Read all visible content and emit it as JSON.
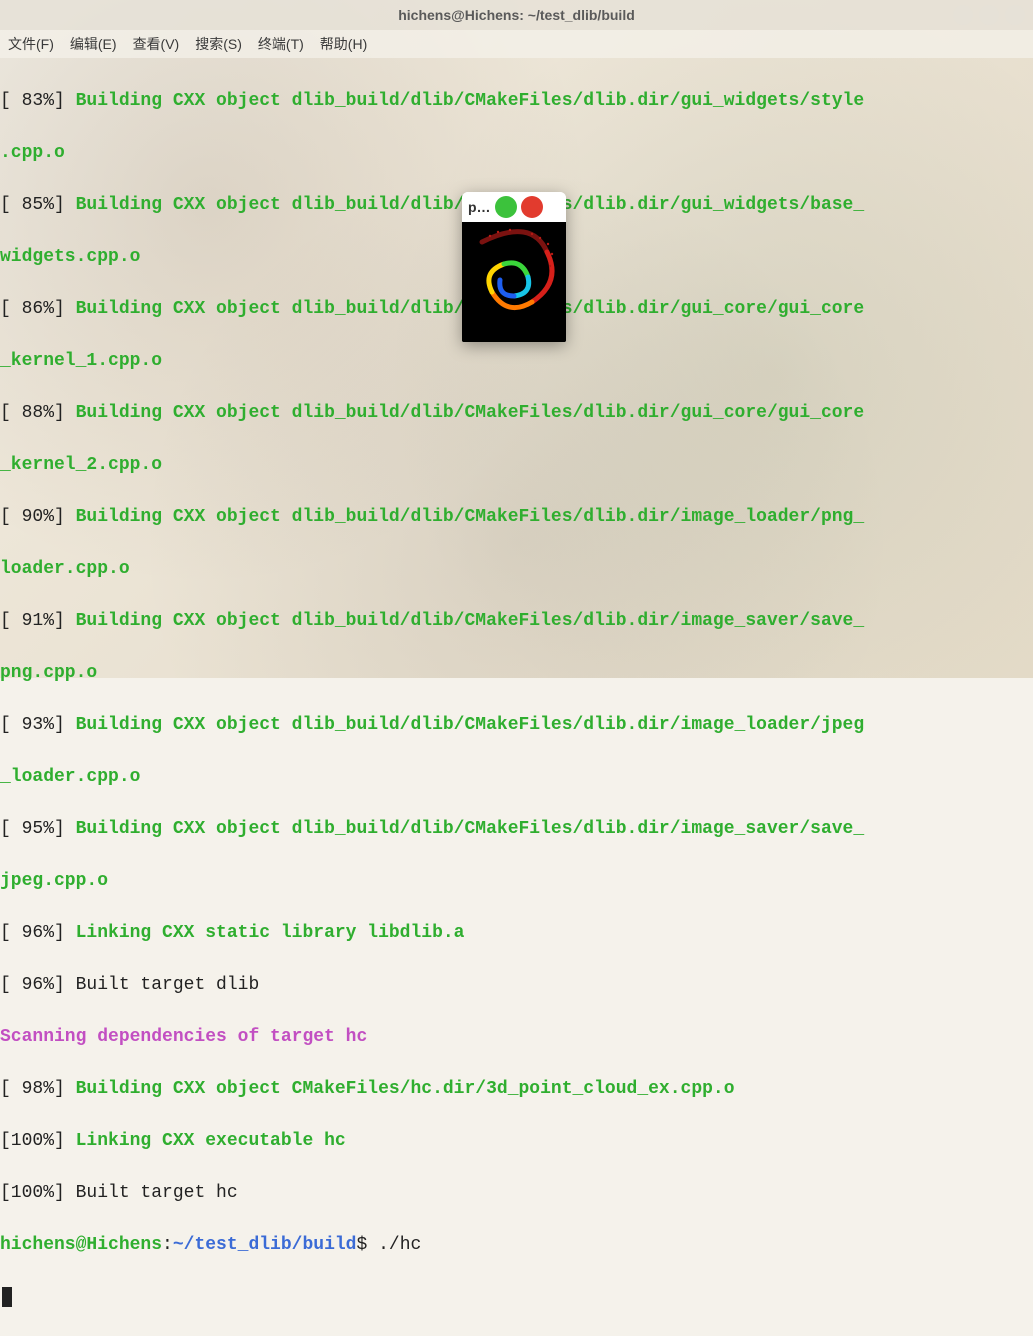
{
  "window": {
    "title": "hichens@Hichens: ~/test_dlib/build"
  },
  "menubar": {
    "items": [
      {
        "label": "文件(F)"
      },
      {
        "label": "编辑(E)"
      },
      {
        "label": "查看(V)"
      },
      {
        "label": "搜索(S)"
      },
      {
        "label": "终端(T)"
      },
      {
        "label": "帮助(H)"
      }
    ]
  },
  "lines": {
    "l0": {
      "pct": "[ 83%] ",
      "txt": "Building CXX object dlib_build/dlib/CMakeFiles/dlib.dir/gui_widgets/style"
    },
    "l0b": ".cpp.o",
    "l1": {
      "pct": "[ 85%] ",
      "txt": "Building CXX object dlib_build/dlib/CMakeFiles/dlib.dir/gui_widgets/base_"
    },
    "l1b": "widgets.cpp.o",
    "l2": {
      "pct": "[ 86%] ",
      "txt": "Building CXX object dlib_build/dlib/CMakeFiles/dlib.dir/gui_core/gui_core"
    },
    "l2b": "_kernel_1.cpp.o",
    "l3": {
      "pct": "[ 88%] ",
      "txt": "Building CXX object dlib_build/dlib/CMakeFiles/dlib.dir/gui_core/gui_core"
    },
    "l3b": "_kernel_2.cpp.o",
    "l4": {
      "pct": "[ 90%] ",
      "txt": "Building CXX object dlib_build/dlib/CMakeFiles/dlib.dir/image_loader/png_"
    },
    "l4b": "loader.cpp.o",
    "l5": {
      "pct": "[ 91%] ",
      "txt": "Building CXX object dlib_build/dlib/CMakeFiles/dlib.dir/image_saver/save_"
    },
    "l5b": "png.cpp.o",
    "l6": {
      "pct": "[ 93%] ",
      "txt": "Building CXX object dlib_build/dlib/CMakeFiles/dlib.dir/image_loader/jpeg"
    },
    "l6b": "_loader.cpp.o",
    "l7": {
      "pct": "[ 95%] ",
      "txt": "Building CXX object dlib_build/dlib/CMakeFiles/dlib.dir/image_saver/save_"
    },
    "l7b": "jpeg.cpp.o",
    "l8": {
      "pct": "[ 96%] ",
      "txt": "Linking CXX static library libdlib.a"
    },
    "l9": {
      "pct": "[ 96%] ",
      "txt": "Built target dlib"
    },
    "l10": "Scanning dependencies of target hc",
    "l11": {
      "pct": "[ 98%] ",
      "txt": "Building CXX object CMakeFiles/hc.dir/3d_point_cloud_ex.cpp.o"
    },
    "l12": {
      "pct": "[100%] ",
      "txt": "Linking CXX executable hc"
    },
    "l13": {
      "pct": "[100%] ",
      "txt": "Built target hc"
    }
  },
  "prompt": {
    "user": "hichens@Hichens",
    "sep1": ":",
    "path": "~/test_dlib/build",
    "sep2": "$ ",
    "cmd": "./hc"
  },
  "popup": {
    "title": "p…"
  }
}
